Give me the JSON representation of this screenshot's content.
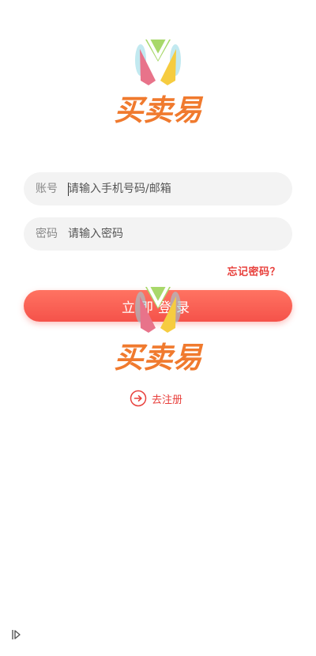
{
  "brand": {
    "logo_name": "买卖易",
    "colors": {
      "green": "#a8d86a",
      "pink": "#e8738a",
      "yellow": "#f6cc40",
      "cyan": "#8fd7e4",
      "orange": "#f07a2e"
    }
  },
  "account_field": {
    "label": "账号",
    "placeholder": "请输入手机号码/邮箱"
  },
  "password_field": {
    "label": "密码",
    "placeholder": "请输入密码"
  },
  "forgot_label": "忘记密码？",
  "login_label": "立即登录",
  "register": {
    "icon": "arrow-right-circle-icon",
    "label": "去注册"
  },
  "corner_icon": "expand-arrow-icon",
  "accent_color": "#f5524a"
}
